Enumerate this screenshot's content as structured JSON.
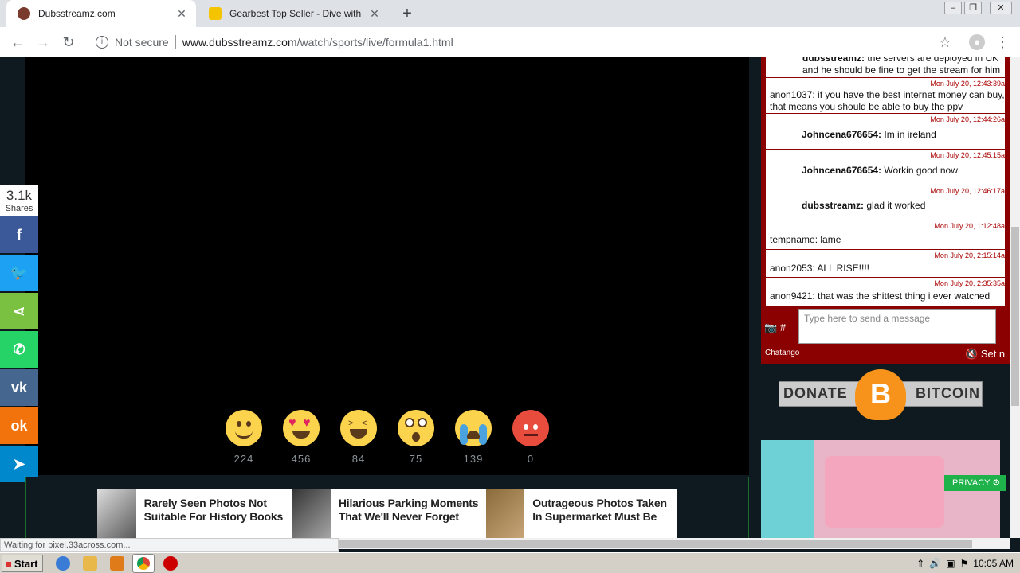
{
  "browser": {
    "tabs": [
      {
        "title": "Dubsstreamz.com",
        "active": true
      },
      {
        "title": "Gearbest Top Seller - Dive with the C",
        "active": false
      }
    ],
    "security_label": "Not secure",
    "url_host": "www.dubsstreamz.com",
    "url_path": "/watch/sports/live/formula1.html"
  },
  "share": {
    "count": "3.1k",
    "label": "Shares",
    "buttons": [
      {
        "name": "facebook",
        "glyph": "f",
        "color": "#3b5998"
      },
      {
        "name": "twitter",
        "glyph": "🐦",
        "color": "#1da1f2"
      },
      {
        "name": "share",
        "glyph": "⋖",
        "color": "#7ac142"
      },
      {
        "name": "whatsapp",
        "glyph": "✆",
        "color": "#25d366"
      },
      {
        "name": "vk",
        "glyph": "vk",
        "color": "#45668e"
      },
      {
        "name": "odnoklassniki",
        "glyph": "ok",
        "color": "#f2720c"
      },
      {
        "name": "telegram",
        "glyph": "➤",
        "color": "#0088cc"
      }
    ]
  },
  "reactions": [
    {
      "name": "smile",
      "count": "224"
    },
    {
      "name": "love",
      "count": "456"
    },
    {
      "name": "laugh",
      "count": "84"
    },
    {
      "name": "wow",
      "count": "75"
    },
    {
      "name": "sad",
      "count": "139"
    },
    {
      "name": "angry",
      "count": "0"
    }
  ],
  "ads": [
    {
      "text": "Rarely Seen Photos Not Suitable For History Books"
    },
    {
      "text": "Hilarious Parking Moments That We'll Never Forget"
    },
    {
      "text": "Outrageous Photos Taken In Supermarket Must Be"
    }
  ],
  "chat": {
    "messages": [
      {
        "user": "dubsstreamz:",
        "text": " the servers are deployed in UK and he should be fine to get the stream for him",
        "ts": ""
      },
      {
        "user": "",
        "text": "anon1037: if you have the best internet money can buy, that means you should be able to buy the ppv",
        "ts": "Mon July 20, 12:43:39a"
      },
      {
        "user": "Johncena676654:",
        "text": " Im in ireland",
        "ts": "Mon July 20, 12:44:26a"
      },
      {
        "user": "Johncena676654:",
        "text": " Workin good now",
        "ts": "Mon July 20, 12:45:15a"
      },
      {
        "user": "dubsstreamz:",
        "text": " glad it worked",
        "ts": "Mon July 20, 12:46:17a"
      },
      {
        "user": "",
        "text": "tempname: lame",
        "ts": "Mon July 20, 1:12:48a"
      },
      {
        "user": "",
        "text": "anon2053: ALL RISE!!!!",
        "ts": "Mon July 20, 2:15:14a"
      },
      {
        "user": "",
        "text": "anon9421: that was the shittest thing i ever watched",
        "ts": "Mon July 20, 2:35:35a"
      }
    ],
    "input_placeholder": "Type here to send a message",
    "brand": "Chatango",
    "sound_label": "Set n"
  },
  "donate": {
    "left": "DONATE",
    "right": "BITCOIN",
    "symbol": "B"
  },
  "privacy_label": "PRIVACY",
  "status_text": "Waiting for pixel.33across.com...",
  "taskbar": {
    "start_label": "Start",
    "clock": "10:05 AM"
  }
}
